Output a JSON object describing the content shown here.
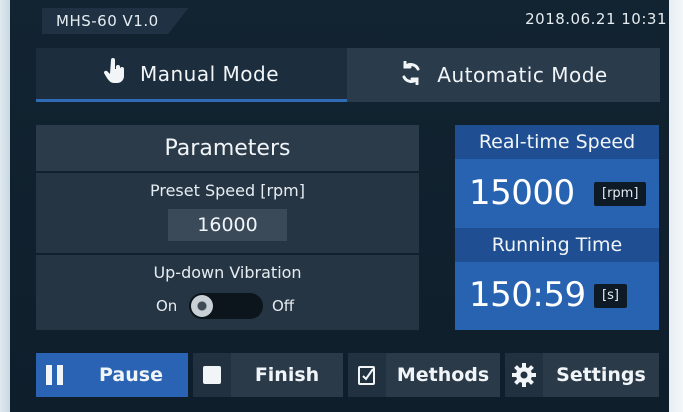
{
  "status_bar": {
    "model": "MHS-60  V1.0",
    "datetime": "2018.06.21   10:31"
  },
  "mode_tabs": {
    "manual": {
      "label": "Manual Mode",
      "icon": "hand-pointer-icon",
      "selected": true
    },
    "automatic": {
      "label": "Automatic Mode",
      "icon": "refresh-icon",
      "selected": false
    }
  },
  "parameters": {
    "title": "Parameters",
    "preset_speed_label": "Preset Speed [rpm]",
    "preset_speed_value": "16000",
    "vibration_label": "Up-down Vibration",
    "vibration_on_label": "On",
    "vibration_off_label": "Off",
    "vibration_state": "On"
  },
  "realtime": {
    "speed_title": "Real-time Speed",
    "speed_value": "15000",
    "speed_unit": "[rpm]",
    "time_title": "Running Time",
    "time_value": "150:59",
    "time_unit": "[s]"
  },
  "buttons": {
    "pause": {
      "label": "Pause",
      "icon": "pause-icon"
    },
    "finish": {
      "label": "Finish",
      "icon": "stop-icon"
    },
    "methods": {
      "label": "Methods",
      "icon": "methods-icon"
    },
    "settings": {
      "label": "Settings",
      "icon": "gear-icon"
    }
  },
  "colors": {
    "accent": "#2a63b3",
    "background": "#122331",
    "panel": "#263543"
  }
}
